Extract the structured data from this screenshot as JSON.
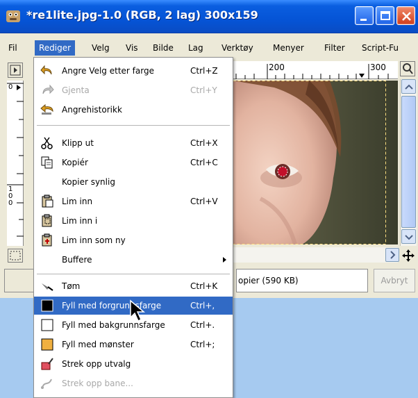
{
  "window": {
    "title": "*re1lite.jpg-1.0 (RGB, 2 lag) 300x159"
  },
  "menubar": {
    "items": [
      "Fil",
      "Rediger",
      "Velg",
      "Vis",
      "Bilde",
      "Lag",
      "Verktøy",
      "Menyer",
      "Filter",
      "Script-Fu"
    ],
    "active": "Rediger"
  },
  "ruler": {
    "top_labels": [
      "200",
      "300"
    ],
    "left_labels": [
      "0",
      "100"
    ]
  },
  "status": {
    "info": "opier (590 KB)",
    "cancel": "Avbryt"
  },
  "menu": {
    "items": [
      {
        "label": "Angre Velg etter farge",
        "shortcut": "Ctrl+Z",
        "icon": "undo-icon",
        "disabled": false
      },
      {
        "label": "Gjenta",
        "shortcut": "Ctrl+Y",
        "icon": "redo-icon",
        "disabled": true
      },
      {
        "label": "Angrehistorikk",
        "shortcut": "",
        "icon": "undo-history-icon",
        "disabled": false
      },
      {
        "label": "Klipp ut",
        "shortcut": "Ctrl+X",
        "icon": "cut-icon",
        "disabled": false
      },
      {
        "label": "Kopiér",
        "shortcut": "Ctrl+C",
        "icon": "copy-icon",
        "disabled": false
      },
      {
        "label": "Kopier synlig",
        "shortcut": "",
        "icon": "",
        "disabled": false
      },
      {
        "label": "Lim inn",
        "shortcut": "Ctrl+V",
        "icon": "paste-icon",
        "disabled": false
      },
      {
        "label": "Lim inn i",
        "shortcut": "",
        "icon": "paste-into-icon",
        "disabled": false
      },
      {
        "label": "Lim inn som ny",
        "shortcut": "",
        "icon": "paste-as-new-icon",
        "disabled": false
      },
      {
        "label": "Buffere",
        "shortcut": "",
        "icon": "",
        "disabled": false,
        "submenu": true
      },
      {
        "label": "Tøm",
        "shortcut": "Ctrl+K",
        "icon": "clear-icon",
        "disabled": false
      },
      {
        "label": "Fyll med forgrunnsfarge",
        "shortcut": "Ctrl+,",
        "icon": "fill-fg-icon",
        "disabled": false,
        "highlighted": true
      },
      {
        "label": "Fyll med bakgrunnsfarge",
        "shortcut": "Ctrl+.",
        "icon": "fill-bg-icon",
        "disabled": false
      },
      {
        "label": "Fyll med mønster",
        "shortcut": "Ctrl+;",
        "icon": "fill-pattern-icon",
        "disabled": false
      },
      {
        "label": "Strek opp utvalg",
        "shortcut": "",
        "icon": "stroke-selection-icon",
        "disabled": false
      },
      {
        "label": "Strek opp bane...",
        "shortcut": "",
        "icon": "stroke-path-icon",
        "disabled": true
      }
    ]
  },
  "colors": {
    "titlebar": "#0554d6",
    "highlight": "#316ac5",
    "desktop": "#a6caf0"
  }
}
